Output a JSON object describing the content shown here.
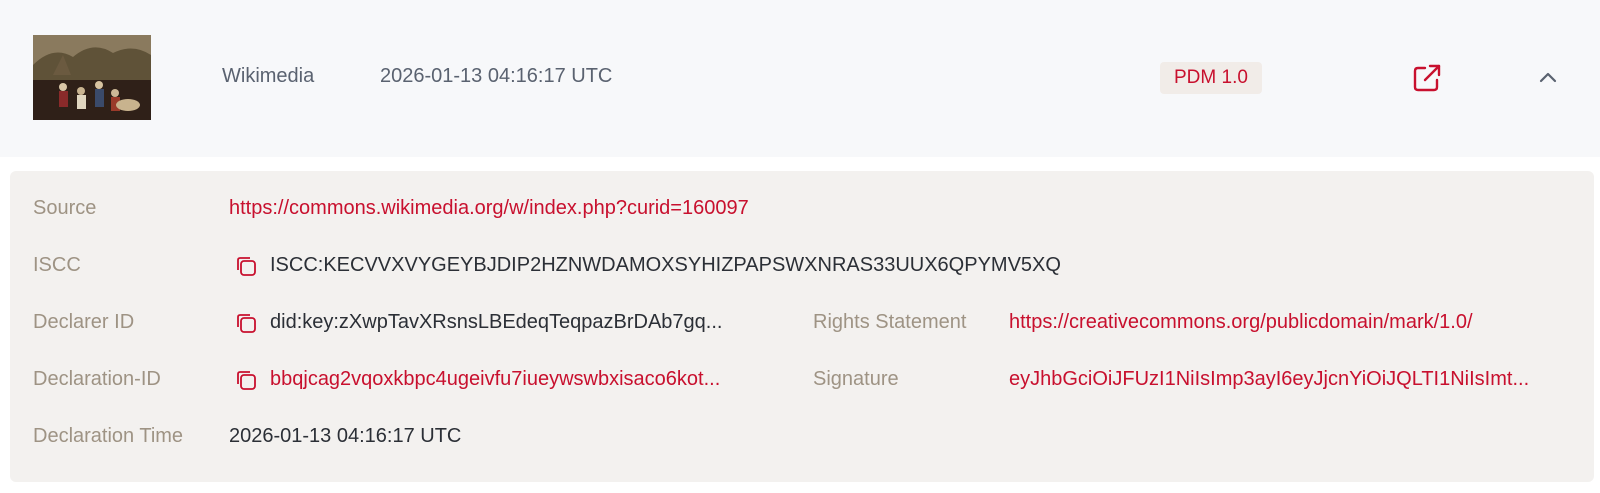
{
  "header": {
    "source_name": "Wikimedia",
    "timestamp": "2026-01-13 04:16:17 UTC",
    "license": "PDM 1.0",
    "open_icon": "external-link-icon",
    "collapse_icon": "chevron-up-icon"
  },
  "details": {
    "source_label": "Source",
    "source_value": "https://commons.wikimedia.org/w/index.php?curid=160097",
    "iscc_label": "ISCC",
    "iscc_value": "ISCC:KECVVXVYGEYBJDIP2HZNWDAMOXSYHIZPAPSWXNRAS33UUX6QPYMV5XQ",
    "declarer_label": "Declarer ID",
    "declarer_value": "did:key:zXwpTavXRsnsLBEdeqTeqpazBrDAb7gq...",
    "rights_label": "Rights Statement",
    "rights_value": "https://creativecommons.org/publicdomain/mark/1.0/",
    "declaration_id_label": "Declaration-ID",
    "declaration_id_value": "bbqjcag2vqoxkbpc4ugeivfu7iueywswbxisaco6kot...",
    "signature_label": "Signature",
    "signature_value": "eyJhbGciOiJFUzI1NiIsImp3ayI6eyJjcnYiOiJQLTI1NiIsImt...",
    "declaration_time_label": "Declaration Time",
    "declaration_time_value": "2026-01-13 04:16:17 UTC",
    "copy_icon": "copy-icon"
  },
  "colors": {
    "accent": "#c8102e",
    "label": "#9e9384",
    "panel": "#f3f1ef",
    "header_bg": "#f7f8fa"
  }
}
